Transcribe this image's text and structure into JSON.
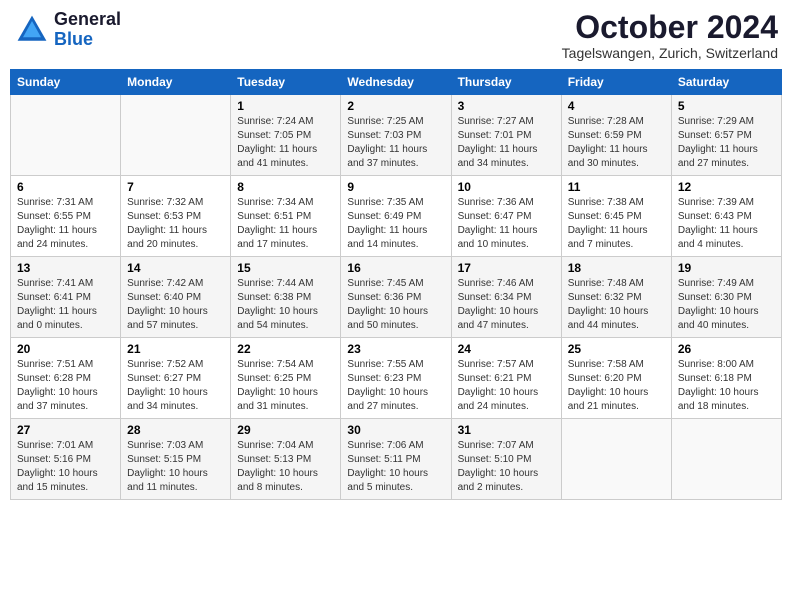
{
  "header": {
    "logo_line1": "General",
    "logo_line2": "Blue",
    "month_year": "October 2024",
    "location": "Tagelswangen, Zurich, Switzerland"
  },
  "days_of_week": [
    "Sunday",
    "Monday",
    "Tuesday",
    "Wednesday",
    "Thursday",
    "Friday",
    "Saturday"
  ],
  "weeks": [
    [
      {
        "day": "",
        "content": ""
      },
      {
        "day": "",
        "content": ""
      },
      {
        "day": "1",
        "content": "Sunrise: 7:24 AM\nSunset: 7:05 PM\nDaylight: 11 hours\nand 41 minutes."
      },
      {
        "day": "2",
        "content": "Sunrise: 7:25 AM\nSunset: 7:03 PM\nDaylight: 11 hours\nand 37 minutes."
      },
      {
        "day": "3",
        "content": "Sunrise: 7:27 AM\nSunset: 7:01 PM\nDaylight: 11 hours\nand 34 minutes."
      },
      {
        "day": "4",
        "content": "Sunrise: 7:28 AM\nSunset: 6:59 PM\nDaylight: 11 hours\nand 30 minutes."
      },
      {
        "day": "5",
        "content": "Sunrise: 7:29 AM\nSunset: 6:57 PM\nDaylight: 11 hours\nand 27 minutes."
      }
    ],
    [
      {
        "day": "6",
        "content": "Sunrise: 7:31 AM\nSunset: 6:55 PM\nDaylight: 11 hours\nand 24 minutes."
      },
      {
        "day": "7",
        "content": "Sunrise: 7:32 AM\nSunset: 6:53 PM\nDaylight: 11 hours\nand 20 minutes."
      },
      {
        "day": "8",
        "content": "Sunrise: 7:34 AM\nSunset: 6:51 PM\nDaylight: 11 hours\nand 17 minutes."
      },
      {
        "day": "9",
        "content": "Sunrise: 7:35 AM\nSunset: 6:49 PM\nDaylight: 11 hours\nand 14 minutes."
      },
      {
        "day": "10",
        "content": "Sunrise: 7:36 AM\nSunset: 6:47 PM\nDaylight: 11 hours\nand 10 minutes."
      },
      {
        "day": "11",
        "content": "Sunrise: 7:38 AM\nSunset: 6:45 PM\nDaylight: 11 hours\nand 7 minutes."
      },
      {
        "day": "12",
        "content": "Sunrise: 7:39 AM\nSunset: 6:43 PM\nDaylight: 11 hours\nand 4 minutes."
      }
    ],
    [
      {
        "day": "13",
        "content": "Sunrise: 7:41 AM\nSunset: 6:41 PM\nDaylight: 11 hours\nand 0 minutes."
      },
      {
        "day": "14",
        "content": "Sunrise: 7:42 AM\nSunset: 6:40 PM\nDaylight: 10 hours\nand 57 minutes."
      },
      {
        "day": "15",
        "content": "Sunrise: 7:44 AM\nSunset: 6:38 PM\nDaylight: 10 hours\nand 54 minutes."
      },
      {
        "day": "16",
        "content": "Sunrise: 7:45 AM\nSunset: 6:36 PM\nDaylight: 10 hours\nand 50 minutes."
      },
      {
        "day": "17",
        "content": "Sunrise: 7:46 AM\nSunset: 6:34 PM\nDaylight: 10 hours\nand 47 minutes."
      },
      {
        "day": "18",
        "content": "Sunrise: 7:48 AM\nSunset: 6:32 PM\nDaylight: 10 hours\nand 44 minutes."
      },
      {
        "day": "19",
        "content": "Sunrise: 7:49 AM\nSunset: 6:30 PM\nDaylight: 10 hours\nand 40 minutes."
      }
    ],
    [
      {
        "day": "20",
        "content": "Sunrise: 7:51 AM\nSunset: 6:28 PM\nDaylight: 10 hours\nand 37 minutes."
      },
      {
        "day": "21",
        "content": "Sunrise: 7:52 AM\nSunset: 6:27 PM\nDaylight: 10 hours\nand 34 minutes."
      },
      {
        "day": "22",
        "content": "Sunrise: 7:54 AM\nSunset: 6:25 PM\nDaylight: 10 hours\nand 31 minutes."
      },
      {
        "day": "23",
        "content": "Sunrise: 7:55 AM\nSunset: 6:23 PM\nDaylight: 10 hours\nand 27 minutes."
      },
      {
        "day": "24",
        "content": "Sunrise: 7:57 AM\nSunset: 6:21 PM\nDaylight: 10 hours\nand 24 minutes."
      },
      {
        "day": "25",
        "content": "Sunrise: 7:58 AM\nSunset: 6:20 PM\nDaylight: 10 hours\nand 21 minutes."
      },
      {
        "day": "26",
        "content": "Sunrise: 8:00 AM\nSunset: 6:18 PM\nDaylight: 10 hours\nand 18 minutes."
      }
    ],
    [
      {
        "day": "27",
        "content": "Sunrise: 7:01 AM\nSunset: 5:16 PM\nDaylight: 10 hours\nand 15 minutes."
      },
      {
        "day": "28",
        "content": "Sunrise: 7:03 AM\nSunset: 5:15 PM\nDaylight: 10 hours\nand 11 minutes."
      },
      {
        "day": "29",
        "content": "Sunrise: 7:04 AM\nSunset: 5:13 PM\nDaylight: 10 hours\nand 8 minutes."
      },
      {
        "day": "30",
        "content": "Sunrise: 7:06 AM\nSunset: 5:11 PM\nDaylight: 10 hours\nand 5 minutes."
      },
      {
        "day": "31",
        "content": "Sunrise: 7:07 AM\nSunset: 5:10 PM\nDaylight: 10 hours\nand 2 minutes."
      },
      {
        "day": "",
        "content": ""
      },
      {
        "day": "",
        "content": ""
      }
    ]
  ]
}
